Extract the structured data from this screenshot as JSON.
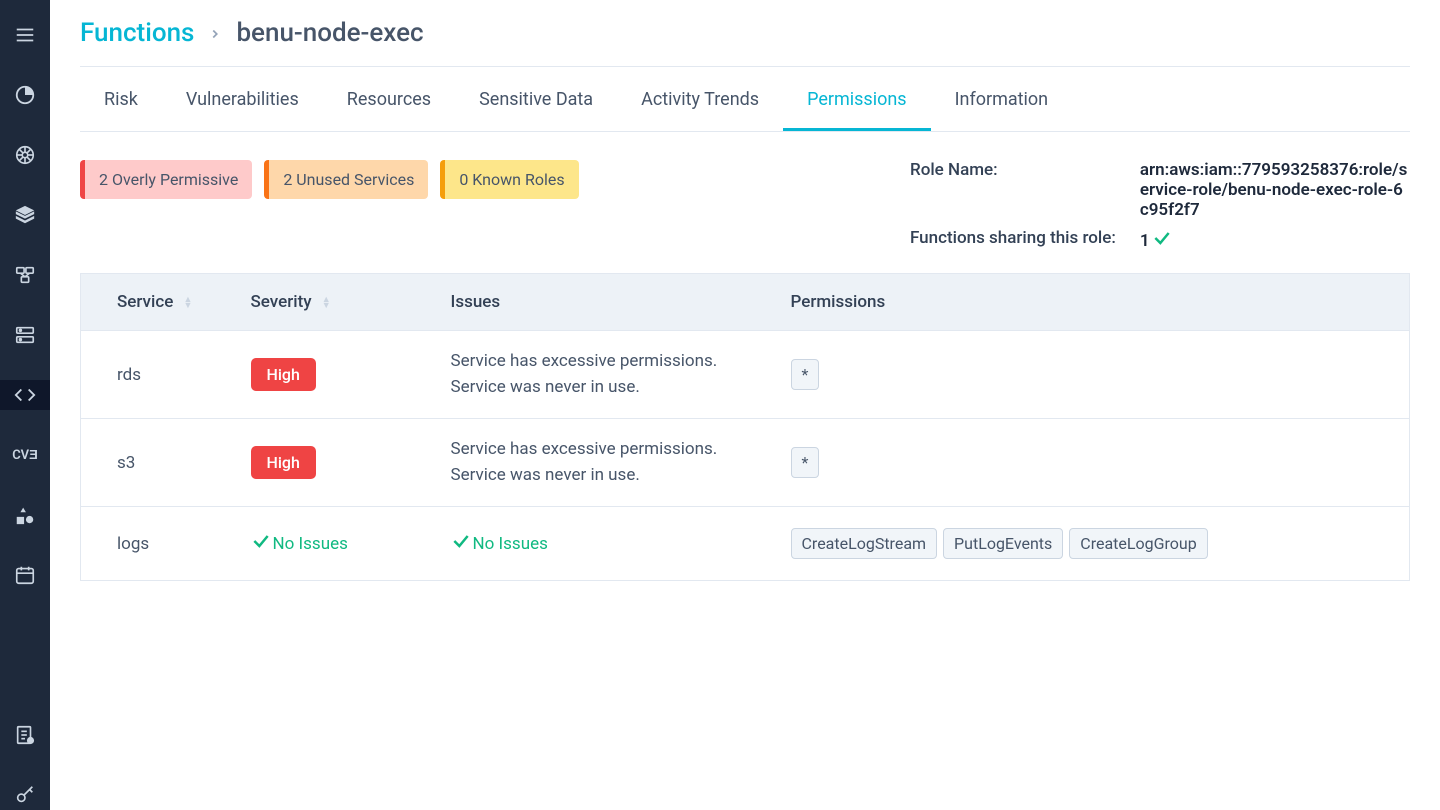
{
  "breadcrumb": {
    "parent": "Functions",
    "current": "benu-node-exec"
  },
  "tabs": [
    {
      "label": "Risk",
      "active": false
    },
    {
      "label": "Vulnerabilities",
      "active": false
    },
    {
      "label": "Resources",
      "active": false
    },
    {
      "label": "Sensitive Data",
      "active": false
    },
    {
      "label": "Activity Trends",
      "active": false
    },
    {
      "label": "Permissions",
      "active": true
    },
    {
      "label": "Information",
      "active": false
    }
  ],
  "badges": [
    {
      "text": "2 Overly Permissive",
      "variant": "red"
    },
    {
      "text": "2 Unused Services",
      "variant": "orange"
    },
    {
      "text": "0 Known Roles",
      "variant": "yellow"
    }
  ],
  "meta": {
    "roleName": {
      "label": "Role Name:",
      "value": "arn:aws:iam::779593258376:role/service-role/benu-node-exec-role-6c95f2f7"
    },
    "sharing": {
      "label": "Functions sharing this role:",
      "value": "1"
    }
  },
  "table": {
    "headers": {
      "service": "Service",
      "severity": "Severity",
      "issues": "Issues",
      "permissions": "Permissions"
    },
    "rows": [
      {
        "service": "rds",
        "severity": "High",
        "issues": [
          "Service has excessive permissions.",
          "Service was never in use."
        ],
        "permissions": [
          "*"
        ]
      },
      {
        "service": "s3",
        "severity": "High",
        "issues": [
          "Service has excessive permissions.",
          "Service was never in use."
        ],
        "permissions": [
          "*"
        ]
      },
      {
        "service": "logs",
        "severity": "none",
        "issues": [],
        "permissions": [
          "CreateLogStream",
          "PutLogEvents",
          "CreateLogGroup"
        ]
      }
    ],
    "noIssues": "No Issues"
  }
}
